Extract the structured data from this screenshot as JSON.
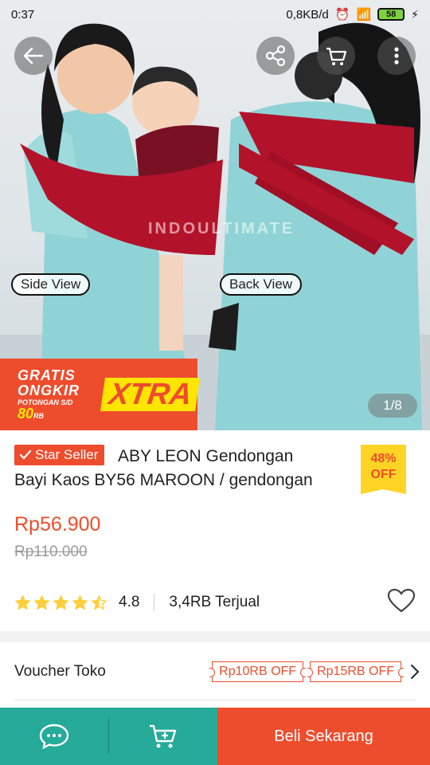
{
  "status_bar": {
    "time": "0:37",
    "network_speed": "0,8KB/d",
    "battery": "58"
  },
  "gallery": {
    "watermark": "INDOULTIMATE",
    "side_label": "Side View",
    "back_label": "Back View",
    "counter": "1/8"
  },
  "promo": {
    "line1": "GRATIS",
    "line2": "ONGKIR",
    "line3_prefix": "POTONGAN S/D",
    "line3_value": "80",
    "line3_suffix": "RB",
    "xtra": "XTRA"
  },
  "product": {
    "badge": "Star Seller",
    "title_line1": "ABY LEON Gendongan",
    "title_line2": "Bayi Kaos BY56 MAROON / gendongan",
    "discount_percent": "48%",
    "discount_off": "OFF",
    "price": "Rp56.900",
    "original_price": "Rp110.000",
    "rating": "4.8",
    "rating_stars": 4.5,
    "sold": "3,4RB Terjual"
  },
  "voucher": {
    "title": "Voucher Toko",
    "items": [
      "Rp10RB OFF",
      "Rp15RB OFF"
    ]
  },
  "bottom_bar": {
    "buy_label": "Beli Sekarang"
  },
  "colors": {
    "brand": "#ee4d2d",
    "teal": "#26aa99",
    "yellow": "#ffd424",
    "star": "#ffce3d"
  },
  "icons": [
    "back-icon",
    "share-icon",
    "cart-icon",
    "more-icon",
    "heart-icon",
    "chat-icon",
    "add-to-cart-icon",
    "chevron-right-icon"
  ]
}
